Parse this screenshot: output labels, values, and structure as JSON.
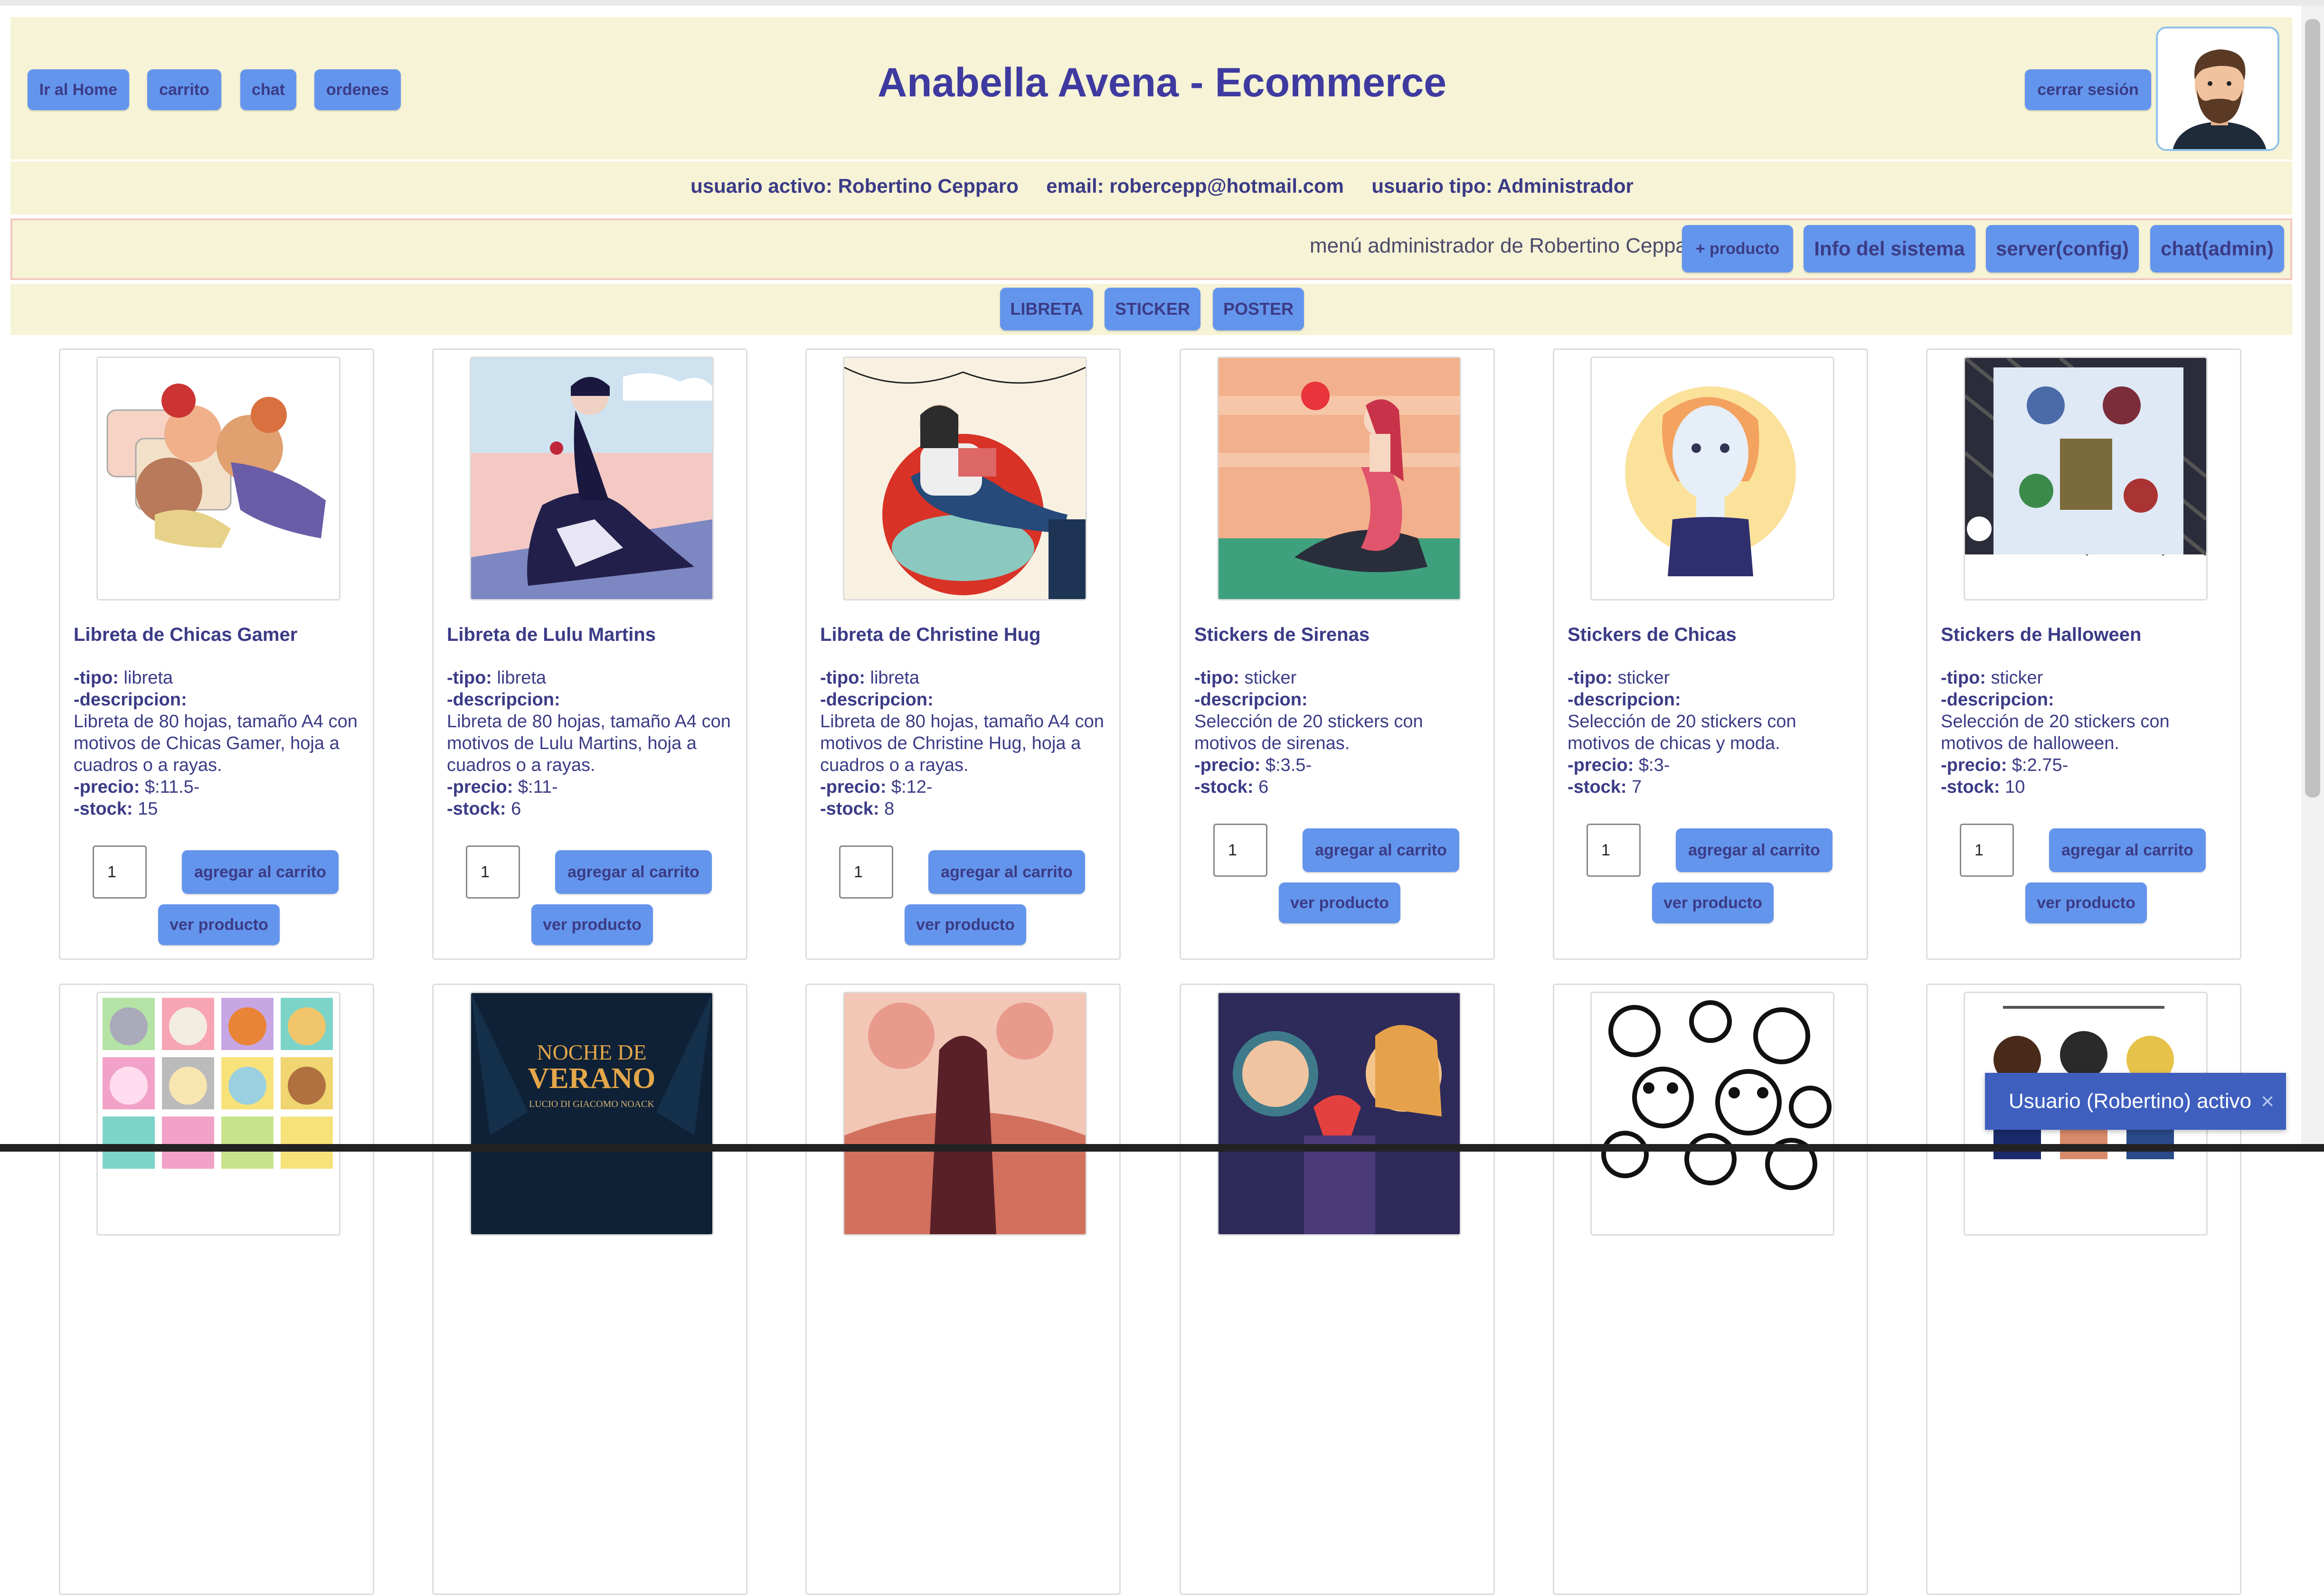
{
  "header": {
    "title": "Anabella Avena - Ecommerce",
    "nav": [
      "Ir al Home",
      "carrito",
      "chat",
      "ordenes"
    ],
    "logout_label": "cerrar sesión"
  },
  "user": {
    "line": "usuario activo: Robertino Cepparo     email: robercepp@hotmail.com     usuario tipo: Administrador"
  },
  "admin": {
    "label": "menú administrador de Robertino Cepparo",
    "buttons": [
      "+ producto",
      "Info del sistema",
      "server(config)",
      "chat(admin)"
    ]
  },
  "filters": [
    "LIBRETA",
    "STICKER",
    "POSTER"
  ],
  "labels": {
    "tipo": "-tipo:",
    "descripcion": "-descripcion:",
    "precio": "-precio:",
    "stock": "-stock:",
    "add_to_cart": "agregar al carrito",
    "view_product": "ver producto"
  },
  "products": [
    {
      "title": "Libreta de Chicas Gamer",
      "tipo": "libreta",
      "descripcion": "Libreta de 80 hojas, tamaño A4 con motivos de Chicas Gamer, hoja a cuadros o a rayas.",
      "precio": "$:11.5-",
      "stock": "15",
      "qty": "1"
    },
    {
      "title": "Libreta de Lulu Martins",
      "tipo": "libreta",
      "descripcion": "Libreta de 80 hojas, tamaño A4 con motivos de Lulu Martins, hoja a cuadros o a rayas.",
      "precio": "$:11-",
      "stock": "6",
      "qty": "1"
    },
    {
      "title": "Libreta de Christine Hug",
      "tipo": "libreta",
      "descripcion": "Libreta de 80 hojas, tamaño A4 con motivos de Christine Hug, hoja a cuadros o a rayas.",
      "precio": "$:12-",
      "stock": "8",
      "qty": "1"
    },
    {
      "title": "Stickers de Sirenas",
      "tipo": "sticker",
      "descripcion": "Selección de 20 stickers con motivos de sirenas.",
      "precio": "$:3.5-",
      "stock": "6",
      "qty": "1"
    },
    {
      "title": "Stickers de Chicas",
      "tipo": "sticker",
      "descripcion": "Selección de 20 stickers con motivos de chicas y moda.",
      "precio": "$:3-",
      "stock": "7",
      "qty": "1"
    },
    {
      "title": "Stickers de Halloween",
      "tipo": "sticker",
      "descripcion": "Selección de 20 stickers con motivos de halloween.",
      "precio": "$:2.75-",
      "stock": "10",
      "qty": "1"
    }
  ],
  "second_row": {
    "poster_title": "NOCHE DE",
    "poster_title2": "VERANO",
    "poster_sub": "LUCIO DI GIACOMO NOACK"
  },
  "toast": {
    "text": "Usuario (Robertino) activo",
    "close_icon": "×"
  },
  "colors": {
    "button": "#6495ed",
    "bar": "#f6f3d6",
    "title": "#3e3aa0",
    "text": "#3b3b86"
  }
}
